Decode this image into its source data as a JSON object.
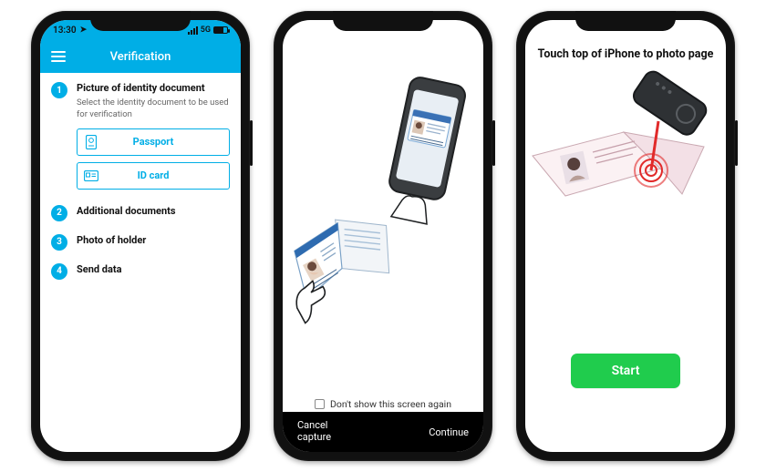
{
  "phone1": {
    "status": {
      "time": "13:30",
      "network": "5G"
    },
    "appbar_title": "Verification",
    "steps": [
      {
        "num": "1",
        "title": "Picture of identity document",
        "desc": "Select the identity document to be used for verification",
        "expanded": true
      },
      {
        "num": "2",
        "title": "Additional documents"
      },
      {
        "num": "3",
        "title": "Photo of holder"
      },
      {
        "num": "4",
        "title": "Send data"
      }
    ],
    "doc_options": {
      "passport": "Passport",
      "idcard": "ID card"
    }
  },
  "phone2": {
    "checkbox_label": "Don't show this screen again",
    "cancel_label": "Cancel\ncapture",
    "continue_label": "Continue"
  },
  "phone3": {
    "title": "Touch top of iPhone to photo page",
    "start_label": "Start"
  }
}
